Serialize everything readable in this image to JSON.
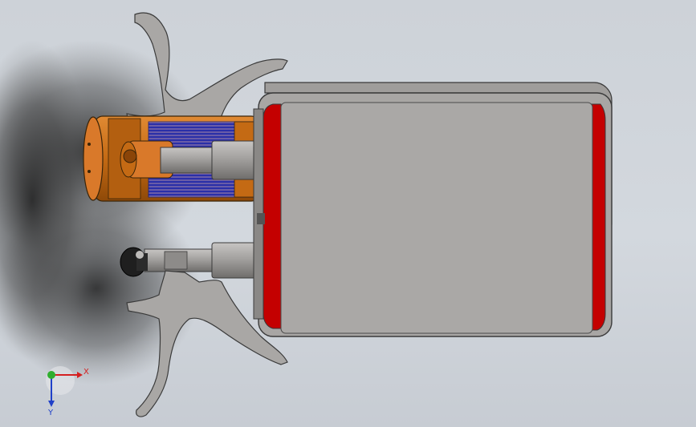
{
  "scene": {
    "colors": {
      "background_top": "#cdd2d8",
      "background_bottom": "#c7ccd3",
      "shadow": "#2b2b2b",
      "body_gray": "#a8a6a4",
      "edge_dark": "#3a3a3a",
      "cap_red": "#c40000",
      "rotor_orange": "#c46a14",
      "winding_blue": "#2a2fa8",
      "shaft_gray": "#9a9896",
      "fork_gray": "#a9a7a5",
      "knob_black": "#1f1f1f"
    }
  },
  "triad": {
    "x_label": "X",
    "y_label": "Y",
    "x_color": "#d42020",
    "y_color": "#2040c8",
    "origin_color": "#2fae2f"
  }
}
